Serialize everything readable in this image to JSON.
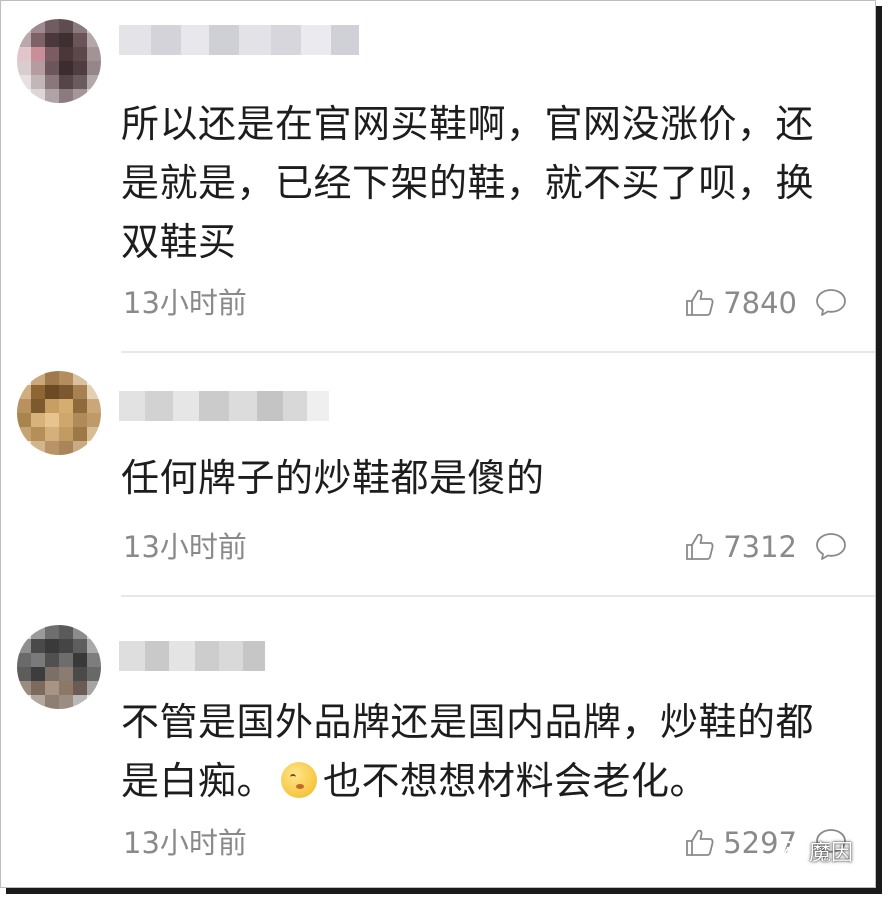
{
  "comments": [
    {
      "text": "所以还是在官网买鞋啊，官网没涨价，还是就是，已经下架的鞋，就不买了呗，换双鞋买",
      "time": "13小时前",
      "likes": "7840",
      "avatar_icon": "blurred-avatar",
      "username_icon": "blurred-username"
    },
    {
      "text": "任何牌子的炒鞋都是傻的",
      "time": "13小时前",
      "likes": "7312",
      "avatar_icon": "blurred-avatar",
      "username_icon": "blurred-username"
    },
    {
      "text_before_emoji": "不管是国外品牌还是国内品牌，炒鞋的都是白痴。",
      "emoji_icon": "shush-emoji",
      "text_after_emoji": "也不想想材料会老化。",
      "time": "13小时前",
      "likes": "5297",
      "avatar_icon": "blurred-avatar",
      "username_icon": "blurred-username"
    }
  ],
  "icons": {
    "like": "thumbs-up-icon",
    "reply": "speech-bubble-icon"
  },
  "watermark": {
    "text": "魔因",
    "icon": "wechat-icon"
  },
  "colors": {
    "text": "#1d1d1d",
    "meta": "#8a8a8a",
    "divider": "#e8e8e8",
    "frame_shadow": "#1a1a1a"
  }
}
